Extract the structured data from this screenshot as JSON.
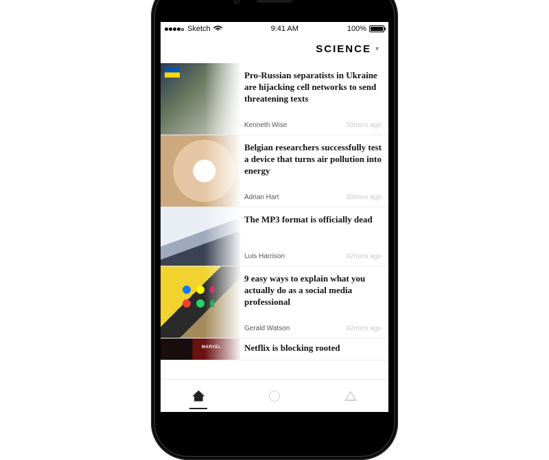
{
  "status_bar": {
    "carrier": "Sketch",
    "time": "9:41 AM",
    "battery_pct": "100%"
  },
  "header": {
    "category": "SCIENCE"
  },
  "articles": [
    {
      "headline": "Pro-Russian separatists in Ukraine are hijacking cell networks to send threatening texts",
      "author": "Kenneth Wise",
      "time": "30mins ago",
      "thumb": "th1"
    },
    {
      "headline": "Belgian researchers successfully test a device that turns air pollution into energy",
      "author": "Adrian Hart",
      "time": "30mins ago",
      "thumb": "th2"
    },
    {
      "headline": "The MP3 format is officially dead",
      "author": "Luis Harrison",
      "time": "42mins ago",
      "thumb": "th3"
    },
    {
      "headline": "9 easy ways to explain what you actually do as a social media professional",
      "author": "Gerald Watson",
      "time": "42mins ago",
      "thumb": "th4"
    },
    {
      "headline": "Netflix is blocking rooted",
      "author": "",
      "time": "",
      "thumb": "th5",
      "peek": true
    }
  ],
  "tabs": [
    {
      "name": "home",
      "active": true
    },
    {
      "name": "circle",
      "active": false
    },
    {
      "name": "triangle",
      "active": false
    }
  ]
}
